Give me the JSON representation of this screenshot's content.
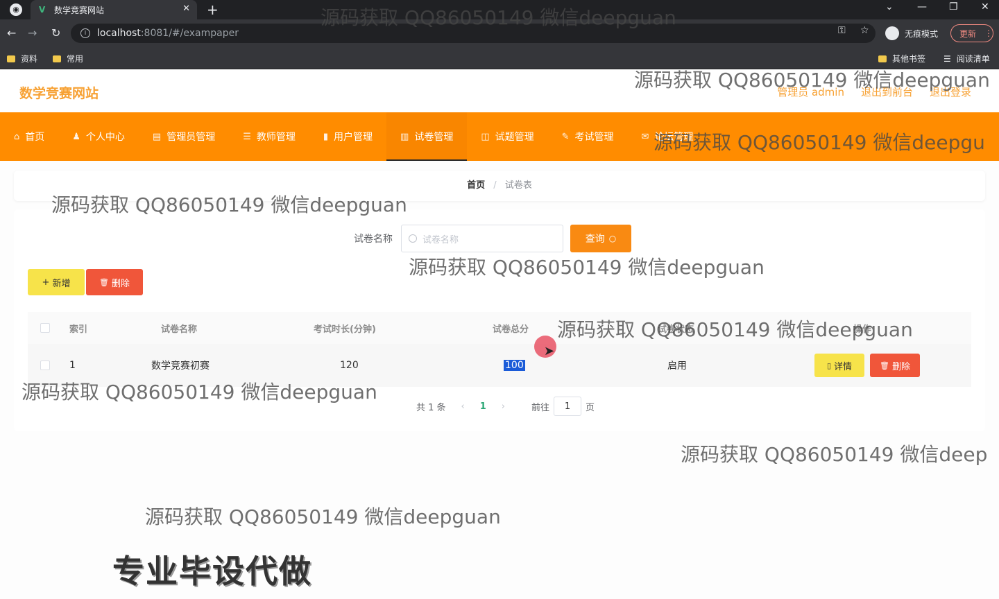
{
  "browser": {
    "tab_title": "数学竞赛网站",
    "tab_icon_char": "V",
    "url_host": "localhost",
    "url_rest": ":8081/#/exampaper",
    "incognito_label": "无痕模式",
    "update_label": "更新",
    "bookmarks": [
      "资料",
      "常用"
    ],
    "bookmarks_right": [
      "其他书签",
      "阅读清单"
    ]
  },
  "site": {
    "title": "数学竞赛网站",
    "admin_label": "管理员 admin",
    "front_link": "退出到前台",
    "logout_link": "退出登录"
  },
  "nav": {
    "items": [
      {
        "label": "首页",
        "icon": "home-icon"
      },
      {
        "label": "个人中心",
        "icon": "user-icon"
      },
      {
        "label": "管理员管理",
        "icon": "admin-icon"
      },
      {
        "label": "教师管理",
        "icon": "teacher-icon"
      },
      {
        "label": "用户管理",
        "icon": "chart-icon"
      },
      {
        "label": "试卷管理",
        "icon": "paper-icon"
      },
      {
        "label": "试题管理",
        "icon": "question-icon"
      },
      {
        "label": "考试管理",
        "icon": "exam-icon"
      },
      {
        "label": "论坛管理",
        "icon": "forum-icon"
      }
    ],
    "active_index": 5
  },
  "breadcrumb": {
    "home": "首页",
    "sep": "/",
    "current": "试卷表"
  },
  "search": {
    "label": "试卷名称",
    "placeholder": "试卷名称",
    "button": "查询"
  },
  "actions": {
    "add": "新增",
    "delete": "删除"
  },
  "table": {
    "headers": [
      "索引",
      "试卷名称",
      "考试时长(分钟)",
      "试卷总分",
      "试卷状态",
      "操作"
    ],
    "rows": [
      {
        "index": "1",
        "name": "数学竞赛初赛",
        "duration": "120",
        "score": "100",
        "status": "启用",
        "detail": "详情",
        "delete": "删除"
      }
    ]
  },
  "pager": {
    "total": "共 1 条",
    "prev": "‹",
    "current_page": "1",
    "next": "›",
    "goto_label": "前往",
    "goto_value": "1",
    "page_suffix": "页"
  },
  "watermarks": [
    "源码获取 QQ86050149 微信deepguan",
    "源码获取 QQ86050149 微信deepguan",
    "源码获取 QQ86050149 微信deepgu",
    "源码获取 QQ86050149 微信deepguan",
    "源码获取 QQ86050149 微信deepguan",
    "源码获取 QQ86050149 微信deepguan",
    "源码获取 QQ86050149 微信deepguan",
    "源码获取 QQ86050149 微信deep",
    "源码获取 QQ86050149 微信deepguan"
  ],
  "promo": "专业毕设代做"
}
